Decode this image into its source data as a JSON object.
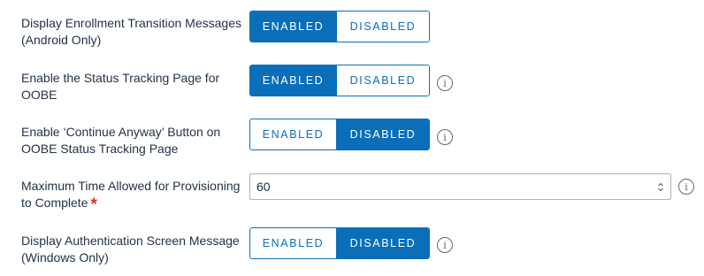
{
  "settings": [
    {
      "label": "Display Enrollment Transition Messages (Android Only)",
      "enabled_label": "ENABLED",
      "disabled_label": "DISABLED",
      "selected": "enabled",
      "has_info": false
    },
    {
      "label": "Enable the Status Tracking Page for OOBE",
      "enabled_label": "ENABLED",
      "disabled_label": "DISABLED",
      "selected": "enabled",
      "has_info": true
    },
    {
      "label": "Enable ‘Continue Anyway’ Button on OOBE Status Tracking Page",
      "enabled_label": "ENABLED",
      "disabled_label": "DISABLED",
      "selected": "disabled",
      "has_info": true
    },
    {
      "label": "Maximum Time Allowed for Provisioning to Complete",
      "required_mark": "*",
      "value": "60",
      "has_info": true
    },
    {
      "label": "Display Authentication Screen Message (Windows Only)",
      "enabled_label": "ENABLED",
      "disabled_label": "DISABLED",
      "selected": "disabled",
      "has_info": true
    }
  ],
  "icons": {
    "info": "info-icon",
    "info_glyph": "i",
    "spinner": "spinner-icon"
  },
  "colors": {
    "accent": "#0a6fb8",
    "required": "#d0352b"
  }
}
